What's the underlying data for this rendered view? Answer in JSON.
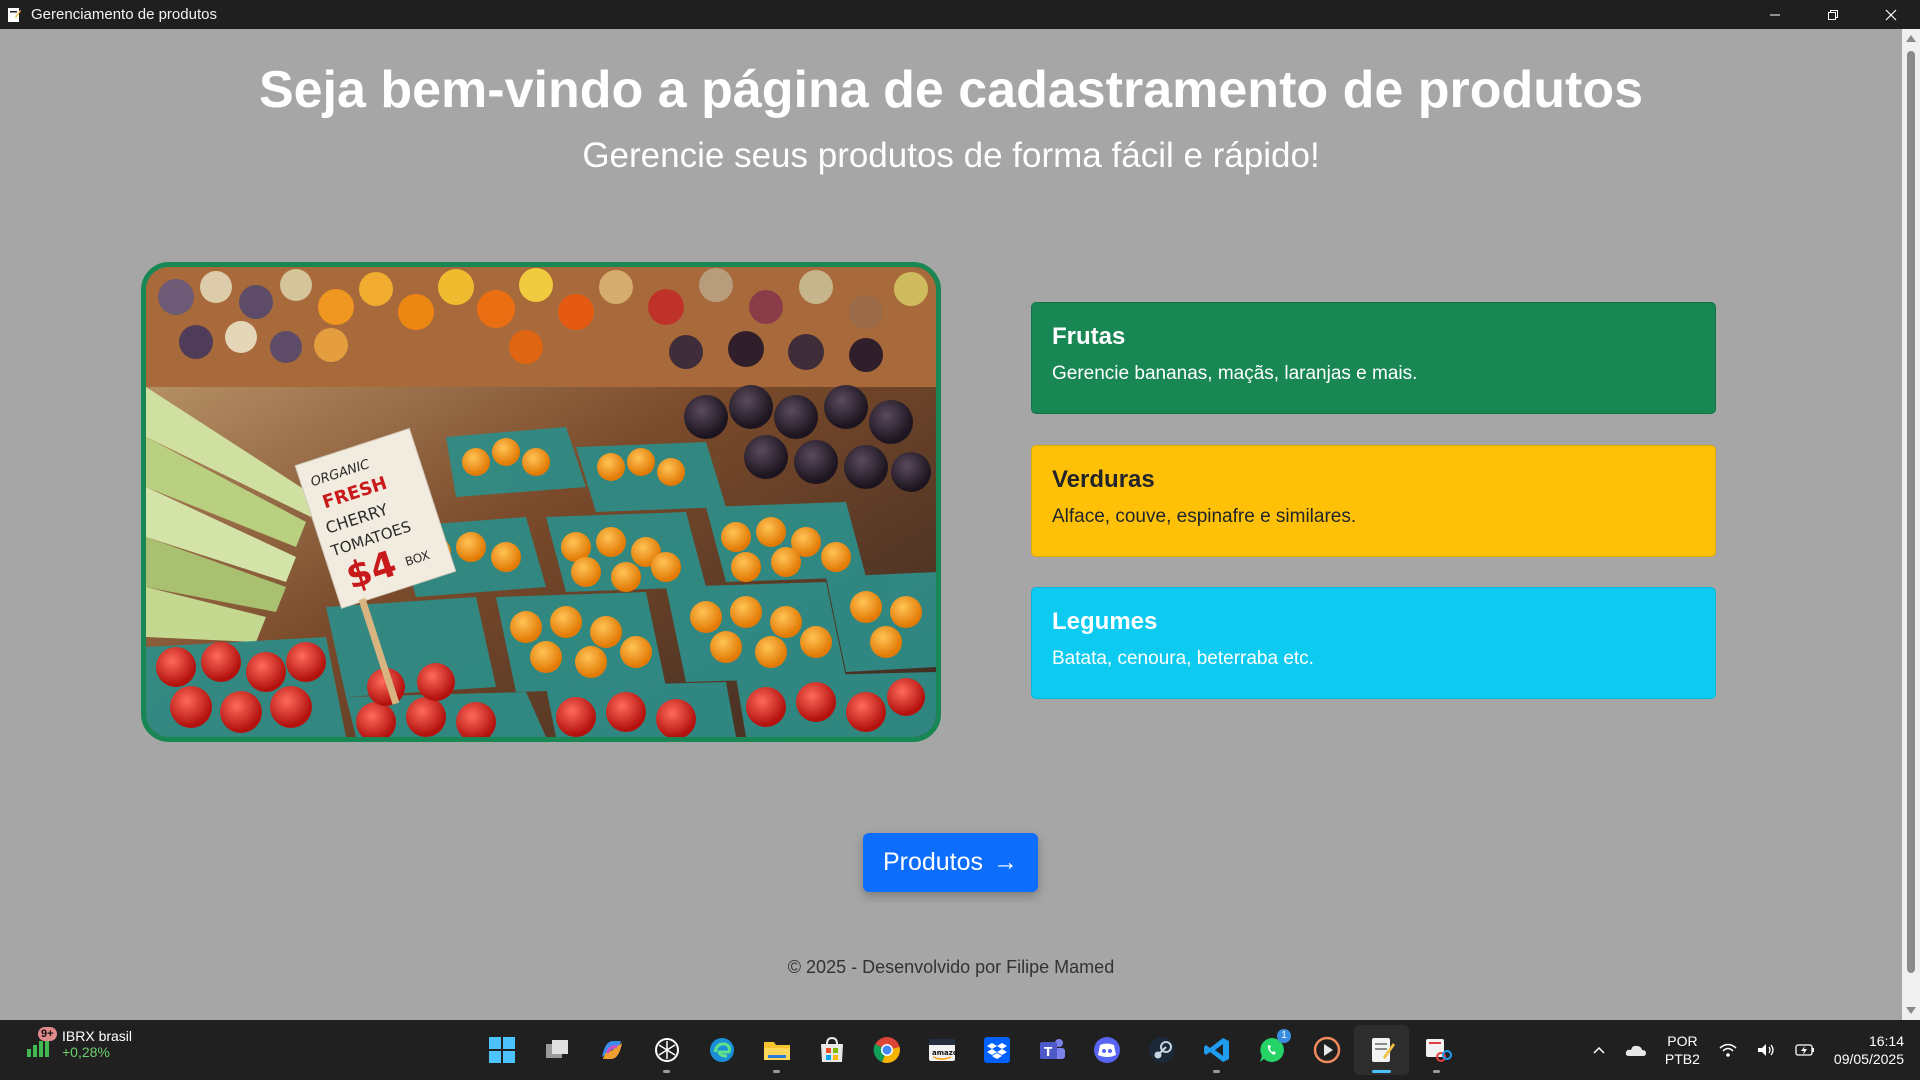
{
  "window": {
    "title": "Gerenciamento de produtos"
  },
  "hero": {
    "title": "Seja bem-vindo a página de cadastramento de produtos",
    "subtitle": "Gerencie seus produtos de forma fácil e rápido!"
  },
  "image": {
    "sign_text": "ORGANIC FRESH CHERRY TOMATOES $4 BOX"
  },
  "cards": [
    {
      "title": "Frutas",
      "text": "Gerencie bananas, maçãs, laranjas e mais.",
      "color": "#198754"
    },
    {
      "title": "Verduras",
      "text": "Alface, couve, espinafre e similares.",
      "color": "#ffc107"
    },
    {
      "title": "Legumes",
      "text": "Batata, cenoura, beterraba etc.",
      "color": "#0dcaf0"
    }
  ],
  "button": {
    "label": "Produtos",
    "arrow": "→",
    "color": "#0d6efd"
  },
  "footer": {
    "text": "© 2025 - Desenvolvido por Filipe Mamed"
  },
  "taskbar": {
    "widget": {
      "badge": "9+",
      "name": "IBRX brasil",
      "change": "+0,28%"
    },
    "apps": [
      "start-icon",
      "task-view-icon",
      "copilot-icon",
      "chatgpt-icon",
      "edge-icon",
      "file-explorer-icon",
      "microsoft-store-icon",
      "chrome-icon",
      "amazon-icon",
      "dropbox-icon",
      "teams-icon",
      "discord-icon",
      "steam-icon",
      "vscode-icon",
      "whatsapp-icon",
      "media-player-icon",
      "notepad-icon",
      "snipping-tool-icon"
    ],
    "whatsapp_badge": "1",
    "language": {
      "line1": "POR",
      "line2": "PTB2"
    },
    "clock": {
      "time": "16:14",
      "date": "09/05/2025"
    }
  }
}
